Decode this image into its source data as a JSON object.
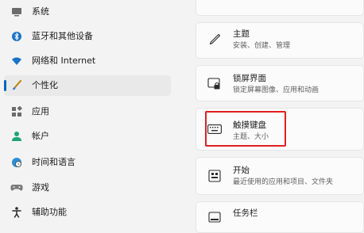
{
  "sidebar": {
    "items": [
      {
        "label": "系统",
        "icon": "system-icon",
        "selected": false
      },
      {
        "label": "蓝牙和其他设备",
        "icon": "bluetooth-icon",
        "selected": false
      },
      {
        "label": "网络和 Internet",
        "icon": "wifi-icon",
        "selected": false
      },
      {
        "label": "个性化",
        "icon": "brush-icon",
        "selected": true
      },
      {
        "label": "应用",
        "icon": "apps-icon",
        "selected": false
      },
      {
        "label": "帐户",
        "icon": "account-icon",
        "selected": false
      },
      {
        "label": "时间和语言",
        "icon": "globe-clock-icon",
        "selected": false
      },
      {
        "label": "游戏",
        "icon": "gamepad-icon",
        "selected": false
      },
      {
        "label": "辅助功能",
        "icon": "accessibility-icon",
        "selected": false
      }
    ]
  },
  "main": {
    "cards": [
      {
        "title": "主题",
        "desc": "安装、创建、管理",
        "icon": "pen-icon"
      },
      {
        "title": "锁屏界面",
        "desc": "锁定屏幕图像、应用和动画",
        "icon": "lock-screen-icon"
      },
      {
        "title": "触摸键盘",
        "desc": "主题、大小",
        "icon": "keyboard-icon",
        "highlighted": true
      },
      {
        "title": "开始",
        "desc": "最近使用的应用和项目、文件夹",
        "icon": "start-icon"
      },
      {
        "title": "任务栏",
        "desc": "",
        "icon": "taskbar-icon"
      }
    ]
  },
  "colors": {
    "accent": "#0067c0",
    "highlight": "#e02020",
    "background": "#f3f3f3",
    "card": "#fbfbfb"
  }
}
